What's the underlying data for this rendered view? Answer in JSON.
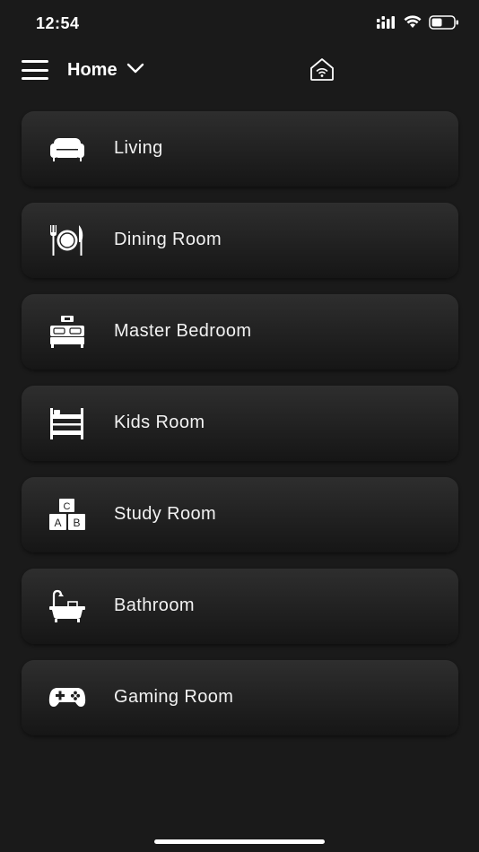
{
  "status_bar": {
    "time": "12:54"
  },
  "header": {
    "home_label": "Home"
  },
  "rooms": [
    {
      "label": "Living",
      "icon": "sofa-icon"
    },
    {
      "label": "Dining Room",
      "icon": "dining-plate-icon"
    },
    {
      "label": "Master Bedroom",
      "icon": "double-bed-icon"
    },
    {
      "label": "Kids Room",
      "icon": "bunk-bed-icon"
    },
    {
      "label": "Study Room",
      "icon": "abc-blocks-icon"
    },
    {
      "label": "Bathroom",
      "icon": "bathtub-icon"
    },
    {
      "label": "Gaming Room",
      "icon": "gamepad-icon"
    }
  ],
  "colors": {
    "background": "#1a1a1a",
    "card": "#262626",
    "text": "#ffffff"
  }
}
